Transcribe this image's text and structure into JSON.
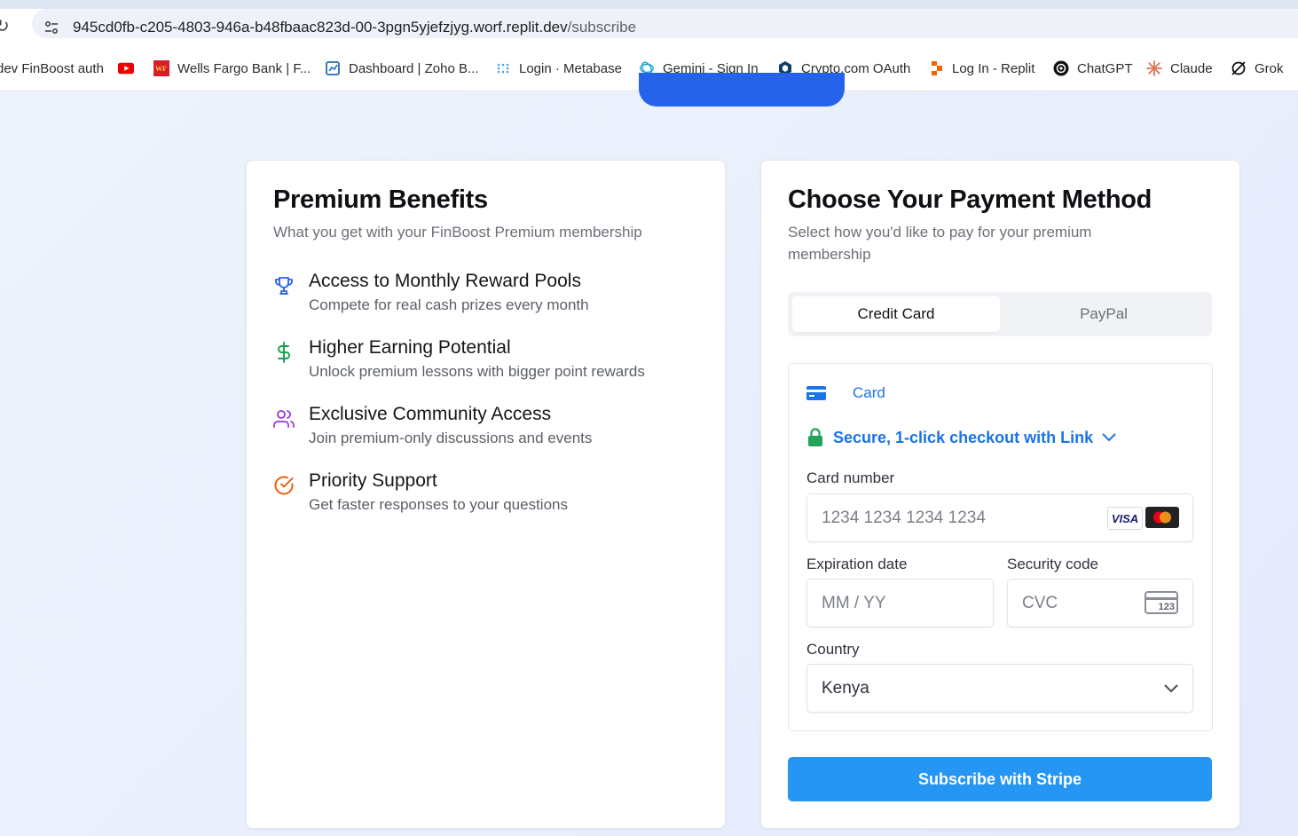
{
  "browser": {
    "url_host": "945cd0fb-c205-4803-946a-b48fbaac823d-00-3pgn5yjefzjyg.worf.replit.dev",
    "url_path": "/subscribe",
    "bookmarks": [
      {
        "label": "dev FinBoost auth",
        "icon": "bookmark-icon"
      },
      {
        "label": "",
        "icon": "youtube-icon"
      },
      {
        "label": "Wells Fargo Bank | F...",
        "icon": "wells-fargo-icon"
      },
      {
        "label": "Dashboard | Zoho B...",
        "icon": "zoho-icon"
      },
      {
        "label": "Login · Metabase",
        "icon": "metabase-icon"
      },
      {
        "label": "Gemini - Sign In",
        "icon": "gemini-icon"
      },
      {
        "label": "Crypto.com OAuth",
        "icon": "crypto-com-icon"
      },
      {
        "label": "Log In - Replit",
        "icon": "replit-icon"
      },
      {
        "label": "ChatGPT",
        "icon": "chatgpt-icon"
      },
      {
        "label": "Claude",
        "icon": "claude-icon"
      },
      {
        "label": "Grok",
        "icon": "grok-icon"
      }
    ]
  },
  "benefits": {
    "title": "Premium Benefits",
    "subtitle": "What you get with your FinBoost Premium membership",
    "items": [
      {
        "title": "Access to Monthly Reward Pools",
        "desc": "Compete for real cash prizes every month",
        "icon": "trophy-icon",
        "color": "#2563eb"
      },
      {
        "title": "Higher Earning Potential",
        "desc": "Unlock premium lessons with bigger point rewards",
        "icon": "dollar-icon",
        "color": "#16a34a"
      },
      {
        "title": "Exclusive Community Access",
        "desc": "Join premium-only discussions and events",
        "icon": "users-icon",
        "color": "#9333ea"
      },
      {
        "title": "Priority Support",
        "desc": "Get faster responses to your questions",
        "icon": "check-circle-icon",
        "color": "#ea580c"
      }
    ]
  },
  "payment": {
    "title": "Choose Your Payment Method",
    "subtitle_line1": "Select how you'd like to pay for your premium",
    "subtitle_line2": "membership",
    "tabs": [
      "Credit Card",
      "PayPal"
    ],
    "method_label": "Card",
    "link_text": "Secure, 1-click checkout with Link",
    "card_number_label": "Card number",
    "card_number_placeholder": "1234 1234 1234 1234",
    "visa_label": "VISA",
    "expiry_label": "Expiration date",
    "expiry_placeholder": "MM / YY",
    "cvc_label": "Security code",
    "cvc_placeholder": "CVC",
    "cvc_icon_text": "123",
    "country_label": "Country",
    "country_value": "Kenya",
    "submit_label": "Subscribe with Stripe"
  },
  "colors": {
    "accent": "#2563eb",
    "stripe_button": "#2596f3",
    "link_blue": "#1a73e8"
  }
}
